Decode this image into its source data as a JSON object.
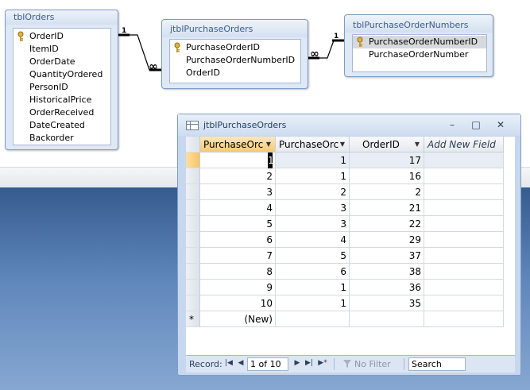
{
  "relationships": {
    "tables": [
      {
        "title": "tblOrders",
        "fields": [
          {
            "name": "OrderID",
            "key": true
          },
          {
            "name": "ItemID",
            "key": false
          },
          {
            "name": "OrderDate",
            "key": false
          },
          {
            "name": "QuantityOrdered",
            "key": false
          },
          {
            "name": "PersonID",
            "key": false
          },
          {
            "name": "HistoricalPrice",
            "key": false
          },
          {
            "name": "OrderReceived",
            "key": false
          },
          {
            "name": "DateCreated",
            "key": false
          },
          {
            "name": "Backorder",
            "key": false
          }
        ]
      },
      {
        "title": "jtblPurchaseOrders",
        "fields": [
          {
            "name": "PurchaseOrderID",
            "key": true
          },
          {
            "name": "PurchaseOrderNumberID",
            "key": false
          },
          {
            "name": "OrderID",
            "key": false
          }
        ]
      },
      {
        "title": "tblPurchaseOrderNumbers",
        "fields": [
          {
            "name": "PurchaseOrderNumberID",
            "key": true,
            "selected": true
          },
          {
            "name": "PurchaseOrderNumber",
            "key": false
          }
        ]
      }
    ],
    "join_labels": {
      "one": "1",
      "many": "∞"
    }
  },
  "datasheet": {
    "title": "jtblPurchaseOrders",
    "window_buttons": {
      "minimize": "–",
      "restore": "□",
      "close": "✕"
    },
    "columns": [
      "PurchaseOrc",
      "PurchaseOrc",
      "OrderID",
      "Add New Field"
    ],
    "rows": [
      [
        "1",
        "1",
        "17"
      ],
      [
        "2",
        "1",
        "16"
      ],
      [
        "3",
        "2",
        "2"
      ],
      [
        "4",
        "3",
        "21"
      ],
      [
        "5",
        "3",
        "22"
      ],
      [
        "6",
        "4",
        "29"
      ],
      [
        "7",
        "5",
        "37"
      ],
      [
        "8",
        "6",
        "38"
      ],
      [
        "9",
        "1",
        "36"
      ],
      [
        "10",
        "1",
        "35"
      ]
    ],
    "new_row": {
      "marker": "*",
      "label": "(New)"
    },
    "navigation": {
      "record_label": "Record:",
      "position": "1 of 10",
      "filter_label": "No Filter",
      "search_label": "Search"
    }
  }
}
